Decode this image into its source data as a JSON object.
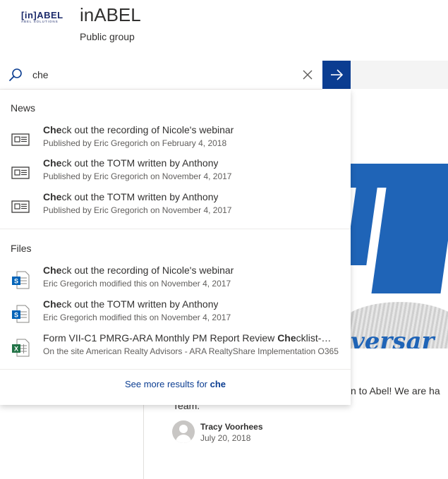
{
  "header": {
    "logo_mark": "[in]ABEL",
    "logo_sub": "ABEL SOLUTIONS",
    "site_title": "inABEL",
    "site_subtitle": "Public group"
  },
  "search": {
    "query": "che",
    "placeholder": "Search"
  },
  "dropdown": {
    "news_label": "News",
    "files_label": "Files",
    "news": [
      {
        "title_match": "Che",
        "title_rest": "ck out the recording of Nicole's webinar",
        "meta": "Published by Eric Gregorich on February 4, 2018",
        "icon": "news-icon"
      },
      {
        "title_match": "Che",
        "title_rest": "ck out the TOTM written by Anthony",
        "meta": "Published by Eric Gregorich on November 4, 2017",
        "icon": "news-icon"
      },
      {
        "title_match": "Che",
        "title_rest": "ck out the TOTM written by Anthony",
        "meta": "Published by Eric Gregorich on November 4, 2017",
        "icon": "news-icon"
      }
    ],
    "files": [
      {
        "title_pre": "",
        "title_match": "Che",
        "title_rest": "ck out the recording of Nicole's webinar",
        "meta": "Eric Gregorich modified this on November 4, 2017",
        "icon": "sharepoint-page-icon"
      },
      {
        "title_pre": "",
        "title_match": "Che",
        "title_rest": "ck out the TOTM written by Anthony",
        "meta": "Eric Gregorich modified this on November 4, 2017",
        "icon": "sharepoint-page-icon"
      },
      {
        "title_pre": "Form VII-C1 PMRG-ARA Monthly PM Report Review ",
        "title_match": "Che",
        "title_rest": "cklist-Co...",
        "meta": "On the site American Realty Advisors - ARA RealtyShare Implementation O365",
        "icon": "excel-icon"
      }
    ],
    "more_prefix": "See more results for ",
    "more_query": "che"
  },
  "background": {
    "hero_script": "versar",
    "post_line1": "n to Abel!  We are ha",
    "post_line2": "Team.",
    "author_name": "Tracy Voorhees",
    "author_date": "July 20, 2018"
  },
  "colors": {
    "accent": "#0b3d91",
    "hero_blue": "#1f64b7",
    "excel_green": "#217346",
    "sharepoint_blue": "#0364b8"
  }
}
